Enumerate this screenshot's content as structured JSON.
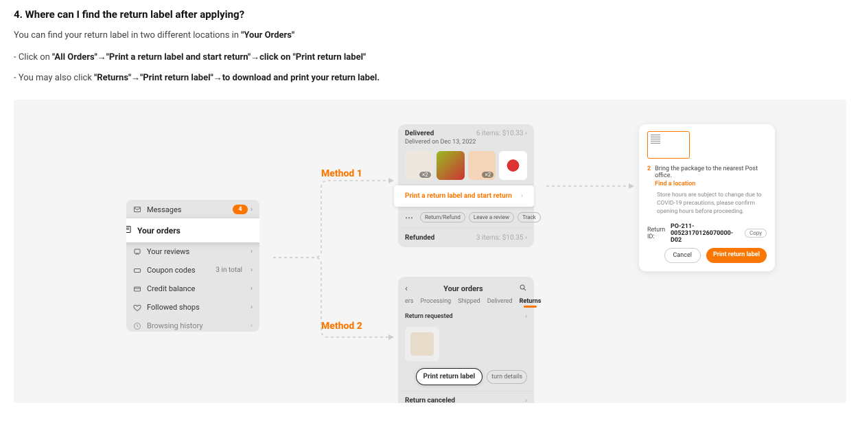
{
  "faq": {
    "heading": "4. Where can I find the return label after applying?",
    "intro_prefix": "You can find your return label in two different locations in ",
    "intro_bold": "\"Your Orders\"",
    "line1_prefix": "- Click on ",
    "line1_bold": "\"All Orders\"→\"Print a return label and start return\"→click on \"Print return label\"",
    "line2_prefix": "- You may also click ",
    "line2_bold": "\"Returns\"→\"Print return label\"→to download and print your return label."
  },
  "methods": {
    "one": "Method 1",
    "two": "Method 2"
  },
  "account_menu": {
    "messages": "Messages",
    "messages_badge": "4",
    "your_orders": "Your orders",
    "your_reviews": "Your reviews",
    "coupon_codes": "Coupon codes",
    "coupon_sub": "3 in total",
    "credit_balance": "Credit balance",
    "followed_shops": "Followed shops",
    "browsing_history": "Browsing history"
  },
  "delivered_card": {
    "status": "Delivered",
    "items_summary": "6 items: $10.33",
    "delivered_on": "Delivered on Dec 13, 2022",
    "thumb1_qty": "×2",
    "thumb3_qty": "×2",
    "banner": "Print a return label and start return",
    "action_return": "Return/Refund",
    "action_review": "Leave a review",
    "action_track": "Track",
    "refunded": "Refunded",
    "refunded_summary": "3 items: $10.35"
  },
  "orders_card": {
    "title": "Your orders",
    "tab_orders_partial": "ers",
    "tab_processing": "Processing",
    "tab_shipped": "Shipped",
    "tab_delivered": "Delivered",
    "tab_returns": "Returns",
    "requested": "Return requested",
    "btn_print": "Print return label",
    "btn_details_partial": "turn details",
    "canceled": "Return canceled"
  },
  "ship_panel": {
    "step_num": "2",
    "step_text": "Bring the package to the nearest Post office.",
    "find_location": "Find a location",
    "note": "Store hours are subject to change due to COVID-19 precautions, please confirm opening hours before proceeding.",
    "return_id_label": "Return ID:",
    "return_id": "PO-211-00523170126070000-D02",
    "copy": "Copy",
    "cancel": "Cancel",
    "print": "Print return label"
  }
}
